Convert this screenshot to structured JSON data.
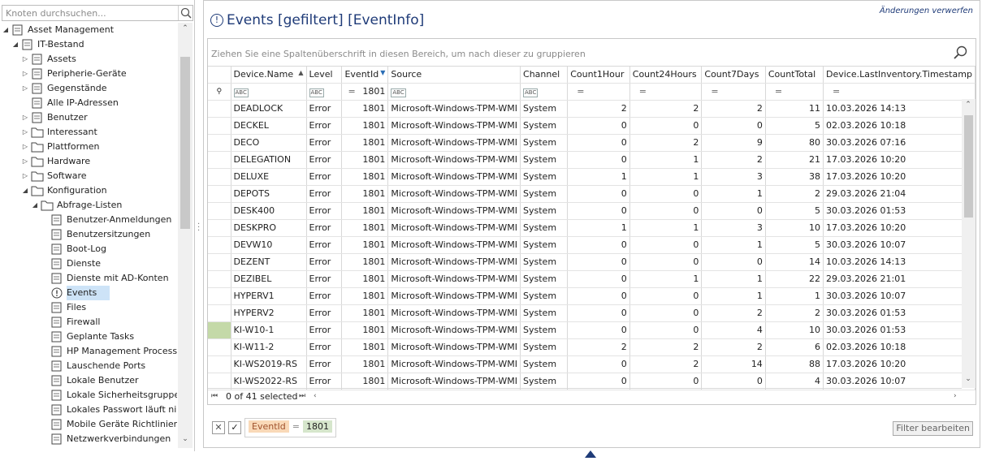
{
  "search": {
    "placeholder": "Knoten durchsuchen..."
  },
  "tree": [
    {
      "label": "Asset Management",
      "level": 0,
      "expander": "open",
      "icon": "hierarchy-icon"
    },
    {
      "label": "IT-Bestand",
      "level": 1,
      "expander": "open",
      "icon": "hierarchy-icon"
    },
    {
      "label": "Assets",
      "level": 2,
      "expander": "closed",
      "icon": "monitor-icon"
    },
    {
      "label": "Peripherie-Geräte",
      "level": 2,
      "expander": "closed",
      "icon": "headset-icon"
    },
    {
      "label": "Gegenstände",
      "level": 2,
      "expander": "closed",
      "icon": "cube-icon"
    },
    {
      "label": "Alle IP-Adressen",
      "level": 2,
      "expander": "none",
      "icon": "network-icon"
    },
    {
      "label": "Benutzer",
      "level": 2,
      "expander": "closed",
      "icon": "user-icon"
    },
    {
      "label": "Interessant",
      "level": 2,
      "expander": "closed",
      "icon": "folder-icon"
    },
    {
      "label": "Plattformen",
      "level": 2,
      "expander": "closed",
      "icon": "folder-icon"
    },
    {
      "label": "Hardware",
      "level": 2,
      "expander": "closed",
      "icon": "folder-icon"
    },
    {
      "label": "Software",
      "level": 2,
      "expander": "closed",
      "icon": "folder-icon"
    },
    {
      "label": "Konfiguration",
      "level": 2,
      "expander": "open",
      "icon": "folder-icon"
    },
    {
      "label": "Abfrage-Listen",
      "level": 3,
      "expander": "open",
      "icon": "folder-icon"
    },
    {
      "label": "Benutzer-Anmeldungen",
      "level": 4,
      "expander": "none",
      "icon": "user-clock-icon"
    },
    {
      "label": "Benutzersitzungen",
      "level": 4,
      "expander": "none",
      "icon": "user-list-icon"
    },
    {
      "label": "Boot-Log",
      "level": 4,
      "expander": "none",
      "icon": "power-icon"
    },
    {
      "label": "Dienste",
      "level": 4,
      "expander": "none",
      "icon": "gear-icon"
    },
    {
      "label": "Dienste mit AD-Konten",
      "level": 4,
      "expander": "none",
      "icon": "gear-user-icon"
    },
    {
      "label": "Events",
      "level": 4,
      "expander": "none",
      "icon": "exclamation-icon",
      "selected": true
    },
    {
      "label": "Files",
      "level": 4,
      "expander": "none",
      "icon": "file-icon"
    },
    {
      "label": "Firewall",
      "level": 4,
      "expander": "none",
      "icon": "firewall-icon"
    },
    {
      "label": "Geplante Tasks",
      "level": 4,
      "expander": "none",
      "icon": "task-clock-icon"
    },
    {
      "label": "HP Management Processor",
      "level": 4,
      "expander": "none",
      "icon": "document-icon"
    },
    {
      "label": "Lauschende Ports",
      "level": 4,
      "expander": "none",
      "icon": "ports-icon"
    },
    {
      "label": "Lokale Benutzer",
      "level": 4,
      "expander": "none",
      "icon": "user-doc-icon"
    },
    {
      "label": "Lokale Sicherheitsgruppen",
      "level": 4,
      "expander": "none",
      "icon": "group-icon"
    },
    {
      "label": "Lokales Passwort läuft nie ab",
      "level": 4,
      "expander": "none",
      "icon": "user-doc-icon"
    },
    {
      "label": "Mobile Geräte Richtlinien",
      "level": 4,
      "expander": "none",
      "icon": "mobile-doc-icon"
    },
    {
      "label": "Netzwerkverbindungen",
      "level": 4,
      "expander": "none",
      "icon": "network-doc-icon"
    }
  ],
  "header": {
    "title": "Events [gefiltert] [EventInfo]",
    "discard_label": "Änderungen verwerfen"
  },
  "grid": {
    "group_panel_text": "Ziehen Sie eine Spaltenüberschrift in diesen Bereich, um nach dieser zu gruppieren",
    "columns": [
      "Device.Name",
      "Level",
      "EventId",
      "Source",
      "Channel",
      "Count1Hour",
      "Count24Hours",
      "Count7Days",
      "CountTotal",
      "Device.LastInventory.Timestamp"
    ],
    "filter_row": {
      "eventid_filter": "1801"
    },
    "rows": [
      [
        "DEADLOCK",
        "Error",
        "1801",
        "Microsoft-Windows-TPM-WMI",
        "System",
        "2",
        "2",
        "2",
        "11",
        "10.03.2026 14:13"
      ],
      [
        "DECKEL",
        "Error",
        "1801",
        "Microsoft-Windows-TPM-WMI",
        "System",
        "0",
        "0",
        "0",
        "5",
        "02.03.2026 10:18"
      ],
      [
        "DECO",
        "Error",
        "1801",
        "Microsoft-Windows-TPM-WMI",
        "System",
        "0",
        "2",
        "9",
        "80",
        "30.03.2026 07:16"
      ],
      [
        "DELEGATION",
        "Error",
        "1801",
        "Microsoft-Windows-TPM-WMI",
        "System",
        "0",
        "1",
        "2",
        "21",
        "17.03.2026 10:20"
      ],
      [
        "DELUXE",
        "Error",
        "1801",
        "Microsoft-Windows-TPM-WMI",
        "System",
        "1",
        "1",
        "3",
        "38",
        "17.03.2026 10:20"
      ],
      [
        "DEPOTS",
        "Error",
        "1801",
        "Microsoft-Windows-TPM-WMI",
        "System",
        "0",
        "0",
        "1",
        "2",
        "29.03.2026 21:04"
      ],
      [
        "DESK400",
        "Error",
        "1801",
        "Microsoft-Windows-TPM-WMI",
        "System",
        "0",
        "0",
        "0",
        "5",
        "30.03.2026 01:53"
      ],
      [
        "DESKPRO",
        "Error",
        "1801",
        "Microsoft-Windows-TPM-WMI",
        "System",
        "1",
        "1",
        "3",
        "10",
        "17.03.2026 10:20"
      ],
      [
        "DEVW10",
        "Error",
        "1801",
        "Microsoft-Windows-TPM-WMI",
        "System",
        "0",
        "0",
        "1",
        "5",
        "30.03.2026 10:07"
      ],
      [
        "DEZENT",
        "Error",
        "1801",
        "Microsoft-Windows-TPM-WMI",
        "System",
        "0",
        "0",
        "0",
        "14",
        "10.03.2026 14:13"
      ],
      [
        "DEZIBEL",
        "Error",
        "1801",
        "Microsoft-Windows-TPM-WMI",
        "System",
        "0",
        "1",
        "1",
        "22",
        "29.03.2026 21:01"
      ],
      [
        "HYPERV1",
        "Error",
        "1801",
        "Microsoft-Windows-TPM-WMI",
        "System",
        "0",
        "0",
        "1",
        "1",
        "30.03.2026 10:07"
      ],
      [
        "HYPERV2",
        "Error",
        "1801",
        "Microsoft-Windows-TPM-WMI",
        "System",
        "0",
        "0",
        "2",
        "2",
        "30.03.2026 01:53"
      ],
      [
        "KI-W10-1",
        "Error",
        "1801",
        "Microsoft-Windows-TPM-WMI",
        "System",
        "0",
        "0",
        "4",
        "10",
        "30.03.2026 01:53"
      ],
      [
        "KI-W11-2",
        "Error",
        "1801",
        "Microsoft-Windows-TPM-WMI",
        "System",
        "2",
        "2",
        "2",
        "6",
        "02.03.2026 10:18"
      ],
      [
        "KI-WS2019-RS",
        "Error",
        "1801",
        "Microsoft-Windows-TPM-WMI",
        "System",
        "0",
        "2",
        "14",
        "88",
        "17.03.2026 10:20"
      ],
      [
        "KI-WS2022-RS",
        "Error",
        "1801",
        "Microsoft-Windows-TPM-WMI",
        "System",
        "0",
        "0",
        "0",
        "4",
        "30.03.2026 10:07"
      ]
    ],
    "highlight_row": 13,
    "highlight_color": "#c4d9a8",
    "footer": {
      "count_text": "0 of 41 selected"
    }
  },
  "filter_bar": {
    "field": "EventId",
    "operator": "=",
    "value": "1801",
    "edit_label": "Filter bearbeiten"
  },
  "colors": {
    "accent": "#1f3b78",
    "selection": "#cde3f7",
    "filter_field": "#f9d9b8",
    "filter_value": "#d6e6cc"
  }
}
